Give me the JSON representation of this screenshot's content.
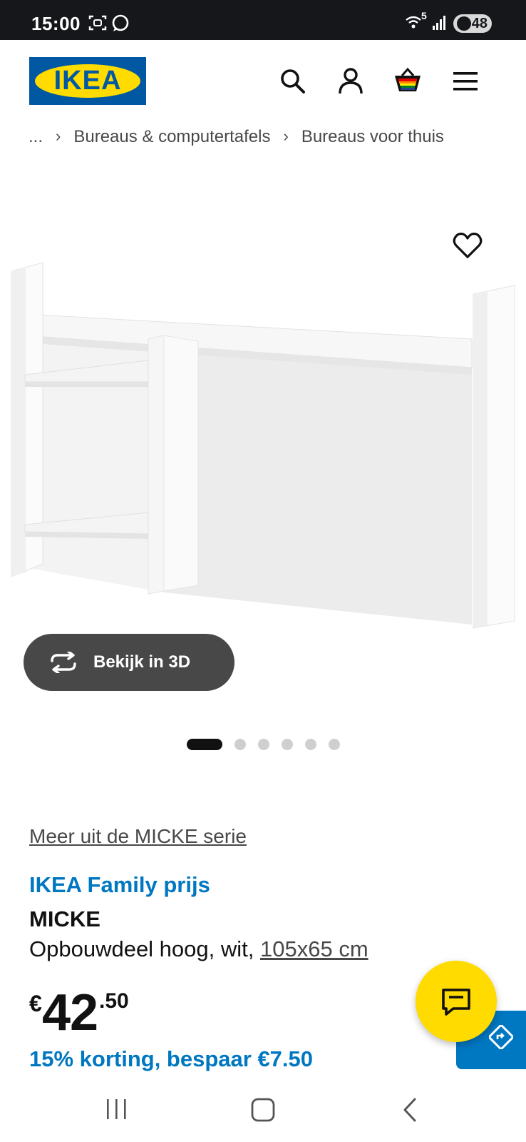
{
  "status_bar": {
    "time": "15:00",
    "network_label": "5",
    "battery": "48",
    "icons": [
      "screenshot-icon",
      "chat-bubble-icon",
      "wifi-icon",
      "signal-icon",
      "battery-icon"
    ]
  },
  "header": {
    "logo_text": "IKEA",
    "icons": [
      "search-icon",
      "account-icon",
      "cart-icon",
      "menu-icon"
    ]
  },
  "breadcrumb": {
    "ellipsis": "...",
    "items": [
      "Bureaus & computertafels",
      "Bureaus voor thuis"
    ]
  },
  "product": {
    "image_icon": "product-photo",
    "view_3d_label": "Bekijk in 3D",
    "carousel": {
      "total": 6,
      "active_index": 0
    },
    "series_link": "Meer uit de MICKE serie",
    "family_price_label": "IKEA Family prijs",
    "name": "MICKE",
    "description": "Opbouwdeel hoog, wit,",
    "dimensions": "105x65 cm",
    "price": {
      "currency": "€",
      "integer": "42",
      "decimal": ".50"
    },
    "discount": "15% korting, bespaar €7.50"
  },
  "colors": {
    "ikea_blue": "#0058a3",
    "ikea_yellow": "#ffdb00",
    "family_blue": "#0077c1",
    "status_bar": "#15171b"
  }
}
